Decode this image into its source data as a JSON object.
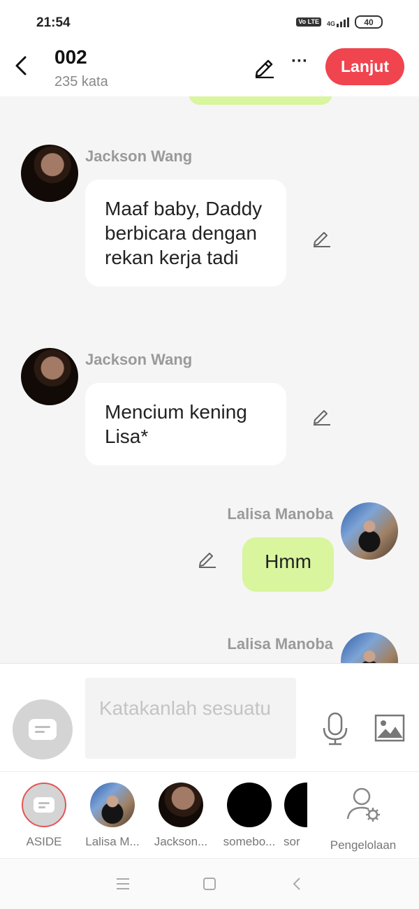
{
  "status_bar": {
    "time": "21:54",
    "volte": "Vo LTE",
    "network": "4G",
    "battery": "40"
  },
  "header": {
    "title": "002",
    "word_count": "235 kata",
    "next_label": "Lanjut",
    "more_glyph": "···"
  },
  "messages": [
    {
      "speaker": "Jackson Wang",
      "text": "Maaf baby, Daddy berbicara dengan rekan kerja tadi",
      "side": "left"
    },
    {
      "speaker": "Jackson Wang",
      "text": "Mencium kening Lisa*",
      "side": "left"
    },
    {
      "speaker": "Lalisa Manoba",
      "text": "Hmm",
      "side": "right"
    },
    {
      "speaker": "Lalisa Manoba",
      "text": "",
      "side": "right"
    }
  ],
  "composer": {
    "placeholder": "Katakanlah sesuatu"
  },
  "roles": [
    {
      "label": "ASIDE"
    },
    {
      "label": "Lalisa M..."
    },
    {
      "label": "Jackson..."
    },
    {
      "label": "somebo..."
    },
    {
      "label": "sor"
    },
    {
      "label": "Pengelolaan"
    }
  ],
  "colors": {
    "accent": "#f0444e",
    "my_bubble": "#d9f59d",
    "speaker_name": "#9a9a9a",
    "placeholder": "#c4c4c4"
  },
  "icons": [
    "back-arrow-icon",
    "pencil-icon",
    "more-icon",
    "message-icon",
    "microphone-icon",
    "image-icon",
    "user-gear-icon",
    "menu-icon",
    "home-square-icon",
    "back-triangle-icon"
  ]
}
